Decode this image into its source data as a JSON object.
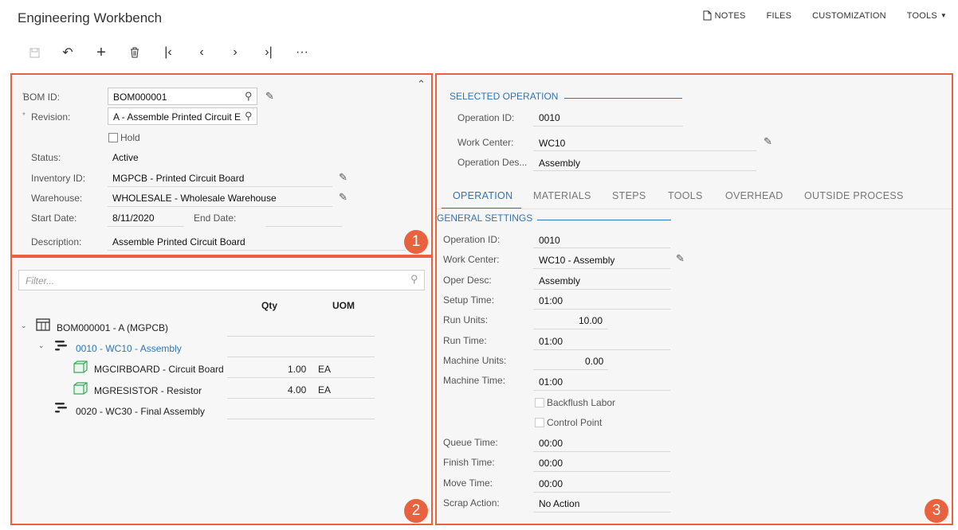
{
  "app": {
    "title": "Engineering Workbench",
    "topnav": {
      "notes": "NOTES",
      "files": "FILES",
      "customization": "CUSTOMIZATION",
      "tools": "TOOLS"
    },
    "toolbar": {
      "save_icon": "save-icon",
      "undo_icon": "undo-icon",
      "add_icon": "add-icon",
      "delete_icon": "trash-icon",
      "first_icon": "first-icon",
      "prev_icon": "prev-icon",
      "next_icon": "next-icon",
      "last_icon": "last-icon",
      "more_icon": "more-icon"
    }
  },
  "panel1": {
    "badge": "1",
    "bom_id_label": "BOM ID:",
    "bom_id": "BOM000001",
    "revision_label": "Revision:",
    "revision": "A - Assemble Printed Circuit E",
    "hold_label": "Hold",
    "status_label": "Status:",
    "status": "Active",
    "inventory_label": "Inventory ID:",
    "inventory": "MGPCB - Printed Circuit Board",
    "warehouse_label": "Warehouse:",
    "warehouse": "WHOLESALE - Wholesale Warehouse",
    "start_label": "Start Date:",
    "start": "8/11/2020",
    "end_label": "End Date:",
    "desc_label": "Description:",
    "desc": "Assemble Printed Circuit Board"
  },
  "panel2": {
    "badge": "2",
    "filter_placeholder": "Filter...",
    "col_qty": "Qty",
    "col_uom": "UOM",
    "root": "BOM000001 - A (MGPCB)",
    "op1": "0010 - WC10 - Assembly",
    "mat1": {
      "name": "MGCIRBOARD - Circuit Board",
      "qty": "1.00",
      "uom": "EA"
    },
    "mat2": {
      "name": "MGRESISTOR - Resistor",
      "qty": "4.00",
      "uom": "EA"
    },
    "op2": "0020 - WC30 - Final Assembly"
  },
  "panel3": {
    "badge": "3",
    "selected_header": "SELECTED OPERATION",
    "op_id_label": "Operation ID:",
    "op_id": "0010",
    "wc_label": "Work Center:",
    "wc": "WC10",
    "op_desc_label": "Operation Des...",
    "op_desc": "Assembly",
    "tabs": [
      "OPERATION",
      "MATERIALS",
      "STEPS",
      "TOOLS",
      "OVERHEAD",
      "OUTSIDE PROCESS"
    ],
    "general_header": "GENERAL SETTINGS",
    "fields": {
      "op_id_label": "Operation ID:",
      "op_id": "0010",
      "wc_label": "Work Center:",
      "wc": "WC10 - Assembly",
      "desc_label": "Oper Desc:",
      "desc": "Assembly",
      "setup_label": "Setup Time:",
      "setup": "01:00",
      "run_units_label": "Run Units:",
      "run_units": "10.00",
      "run_time_label": "Run Time:",
      "run_time": "01:00",
      "machine_units_label": "Machine Units:",
      "machine_units": "0.00",
      "machine_time_label": "Machine Time:",
      "machine_time": "01:00",
      "backflush_label": "Backflush Labor",
      "control_label": "Control Point",
      "queue_label": "Queue Time:",
      "queue": "00:00",
      "finish_label": "Finish Time:",
      "finish": "00:00",
      "move_label": "Move Time:",
      "move": "00:00",
      "scrap_label": "Scrap Action:",
      "scrap": "No Action"
    }
  },
  "colors": {
    "accent": "#2f75b5",
    "highlight": "#e8623f"
  }
}
